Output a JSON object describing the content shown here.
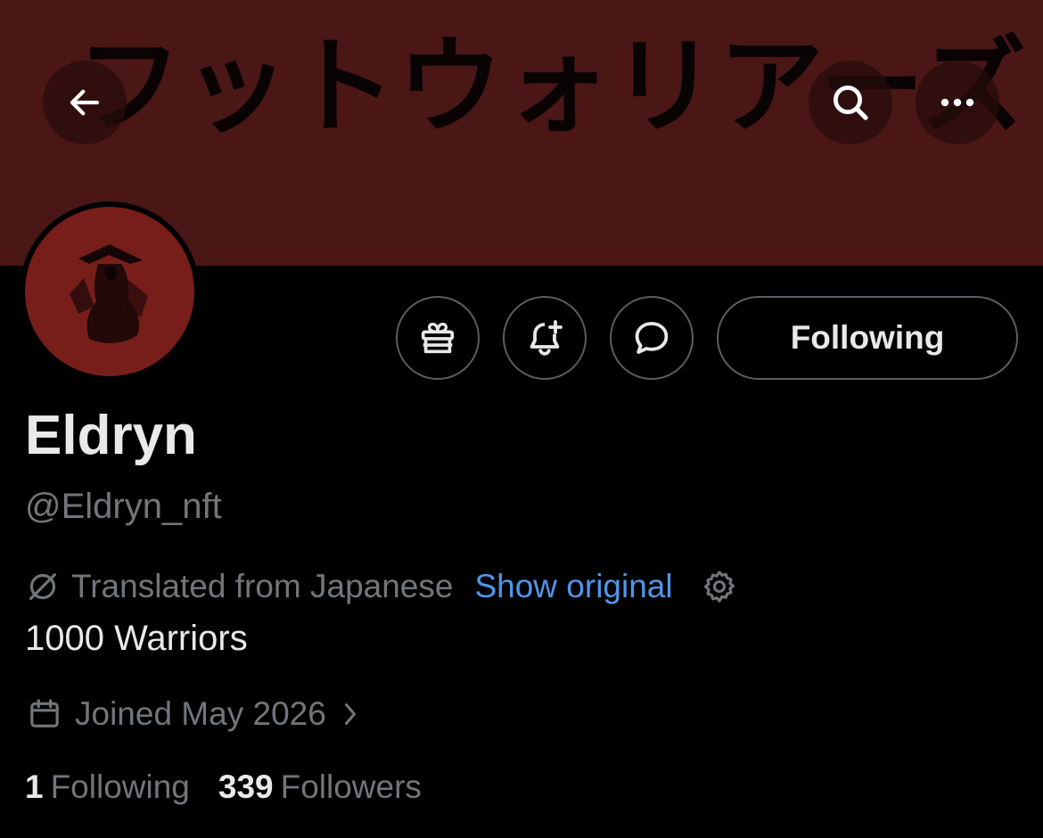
{
  "banner": {
    "text": "フットウォリアーズ",
    "color": "#4a1616"
  },
  "header": {
    "back_icon": "arrow-left-icon",
    "search_icon": "search-icon",
    "more_icon": "ellipsis-icon"
  },
  "profile": {
    "display_name": "Eldryn",
    "handle": "@Eldryn_nft",
    "bio": "1000 Warriors",
    "translation": {
      "label": "Translated from Japanese",
      "show_original": "Show original",
      "accent": "#4f95e8"
    },
    "joined": "Joined May 2026"
  },
  "actions": {
    "gift_icon": "gift-icon",
    "bell_icon": "bell-plus-icon",
    "message_icon": "message-icon",
    "following_label": "Following"
  },
  "stats": {
    "following_count": "1",
    "following_label": "Following",
    "followers_count": "339",
    "followers_label": "Followers"
  }
}
